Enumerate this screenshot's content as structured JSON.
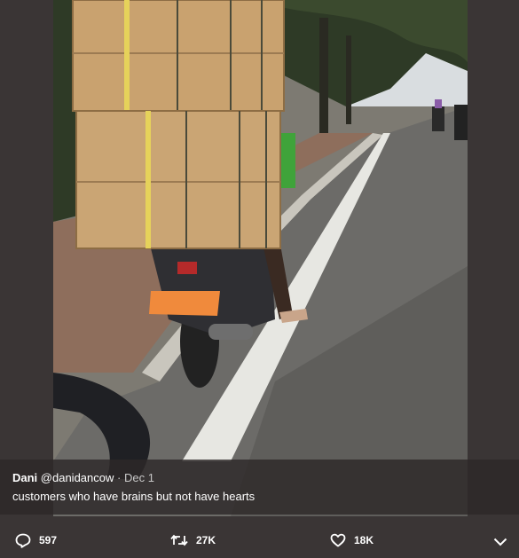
{
  "tweet": {
    "author_name": "Dani",
    "author_handle": "@danidancow",
    "separator": "·",
    "date": "Dec 1",
    "text": "customers who have brains but not have hearts"
  },
  "actions": {
    "reply": {
      "icon": "reply-icon",
      "count": "597"
    },
    "retweet": {
      "icon": "retweet-icon",
      "count": "27K"
    },
    "like": {
      "icon": "heart-icon",
      "count": "18K"
    },
    "more": {
      "icon": "chevron-down-icon"
    }
  },
  "colors": {
    "background": "#3a3535",
    "text": "#ffffff",
    "muted": "#c8c8c8"
  }
}
